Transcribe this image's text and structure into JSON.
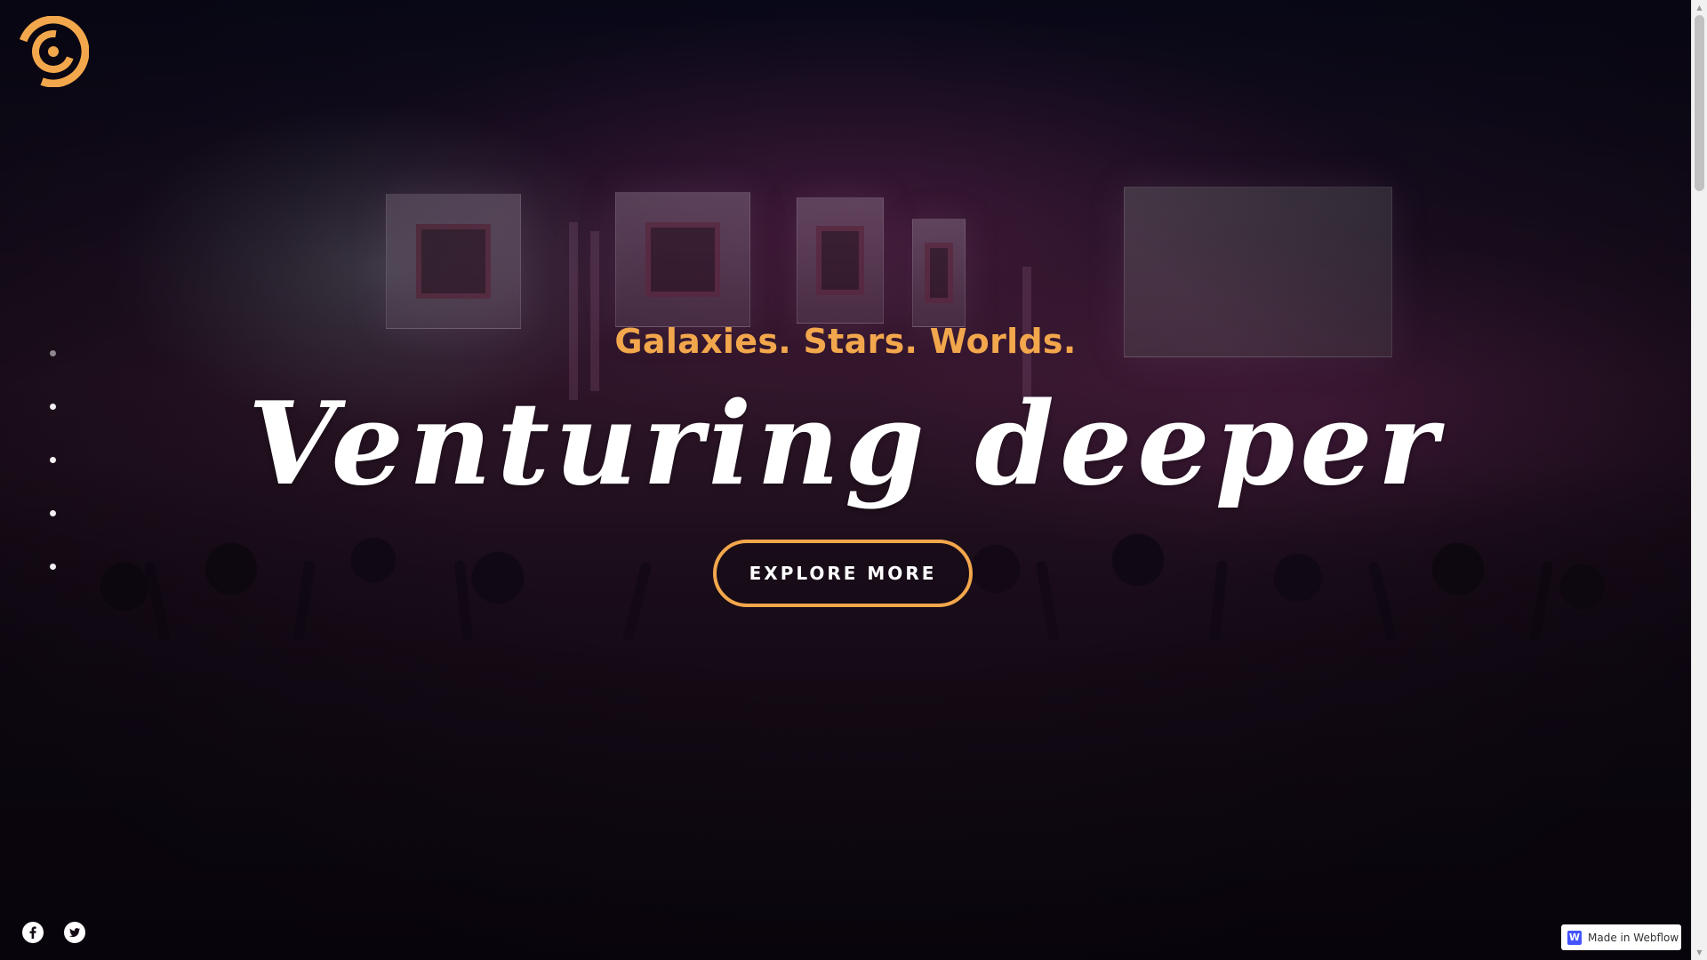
{
  "hero": {
    "tagline": "Galaxies. Stars. Worlds.",
    "headline": "Venturing deeper",
    "cta_label": "EXPLORE MORE"
  },
  "nav": {
    "logo_icon": "swirl-logo-icon",
    "dots_count": 5,
    "active_dot": 1
  },
  "social": [
    {
      "name": "facebook-icon"
    },
    {
      "name": "twitter-icon"
    }
  ],
  "badge": {
    "icon_letter": "W",
    "label": "Made in Webflow"
  },
  "colors": {
    "accent": "#f3a74c",
    "headline": "#ffffff",
    "webflow_blue": "#4353ff"
  },
  "scrollbar": {
    "up_arrow": "▲",
    "down_arrow": "▼"
  }
}
